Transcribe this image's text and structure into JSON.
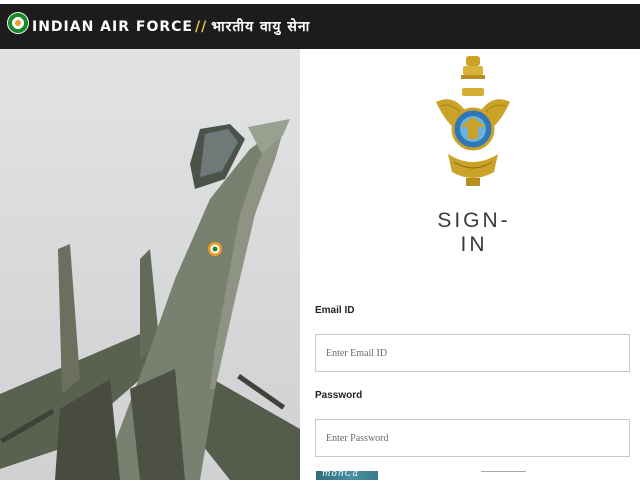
{
  "header": {
    "brand_en": "INDIAN AIR FORCE",
    "separator": "//",
    "brand_hi": "भारतीय वायु सेना"
  },
  "hero": {
    "image": "fighter-jet-photo"
  },
  "login": {
    "title": "SIGN-IN",
    "email_label": "Email ID",
    "email_placeholder": "Enter Email ID",
    "password_label": "Password",
    "password_placeholder": "Enter Password",
    "captcha_text": "mohCa"
  },
  "colors": {
    "header_bg": "#1c1c1c",
    "separator": "#e6c23a",
    "emblem_gold": "#c9a227",
    "emblem_blue": "#2f77b8"
  }
}
